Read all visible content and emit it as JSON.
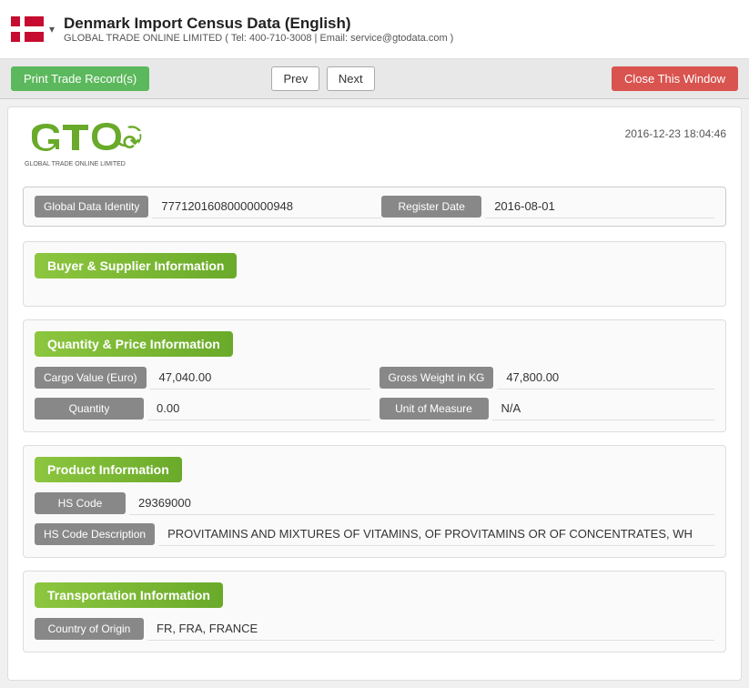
{
  "header": {
    "title": "Denmark Import Census Data (English)",
    "subtitle": "GLOBAL TRADE ONLINE LIMITED ( Tel: 400-710-3008 | Email: service@gtodata.com )",
    "dropdown_icon": "▾"
  },
  "toolbar": {
    "print_label": "Print Trade Record(s)",
    "prev_label": "Prev",
    "next_label": "Next",
    "close_label": "Close This Window"
  },
  "logo": {
    "tagline": "GLOBAL TRADE ONLINE LIMITED",
    "timestamp": "2016-12-23 18:04:46"
  },
  "identity": {
    "global_data_label": "Global Data Identity",
    "global_data_value": "77712016080000000948",
    "register_date_label": "Register Date",
    "register_date_value": "2016-08-01"
  },
  "sections": {
    "buyer_supplier": {
      "title": "Buyer & Supplier Information"
    },
    "quantity_price": {
      "title": "Quantity & Price Information",
      "fields": [
        {
          "label": "Cargo Value (Euro)",
          "value": "47,040.00",
          "label2": "Gross Weight in KG",
          "value2": "47,800.00"
        },
        {
          "label": "Quantity",
          "value": "0.00",
          "label2": "Unit of Measure",
          "value2": "N/A"
        }
      ]
    },
    "product": {
      "title": "Product Information",
      "fields": [
        {
          "label": "HS Code",
          "value": "29369000"
        },
        {
          "label": "HS Code Description",
          "value": "PROVITAMINS AND MIXTURES OF VITAMINS, OF PROVITAMINS OR OF CONCENTRATES, WH"
        }
      ]
    },
    "transportation": {
      "title": "Transportation Information",
      "fields": [
        {
          "label": "Country of Origin",
          "value": "FR, FRA, FRANCE"
        }
      ]
    }
  },
  "colors": {
    "green_btn": "#5cb85c",
    "red_btn": "#d9534f",
    "section_green": "#8dc63f",
    "label_gray": "#888888"
  }
}
